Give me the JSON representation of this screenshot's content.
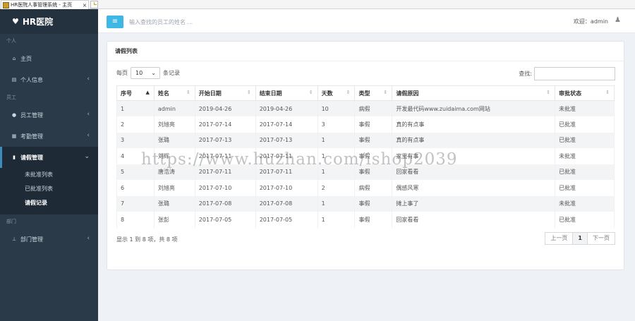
{
  "browser": {
    "tab_title": "HR医院人事管理系统 - 主页",
    "tab_close": "×"
  },
  "sidebar": {
    "brand": "HR医院",
    "sections": [
      {
        "label": "个人",
        "items": [
          {
            "label": "主页",
            "icon": "home-icon",
            "chevron": ""
          },
          {
            "label": "个人信息",
            "icon": "card-icon",
            "chevron": "‹"
          }
        ]
      },
      {
        "label": "员工",
        "items": [
          {
            "label": "员工管理",
            "icon": "user-icon",
            "chevron": "‹"
          },
          {
            "label": "考勤管理",
            "icon": "calendar-icon",
            "chevron": "‹"
          },
          {
            "label": "请假管理",
            "icon": "bookmark-icon",
            "chevron": "⌄"
          }
        ]
      },
      {
        "label": "部门",
        "items": [
          {
            "label": "部门管理",
            "icon": "sitemap-icon",
            "chevron": "‹"
          }
        ]
      }
    ],
    "submenu": [
      "未批准列表",
      "已批准列表",
      "请假记录"
    ]
  },
  "header": {
    "menu_toggle": "≡",
    "search_placeholder": "输入查找的员工的姓名 ...",
    "welcome": "欢迎：admin"
  },
  "panel": {
    "title": "请假列表",
    "length_prefix": "每页",
    "length_value": "10",
    "length_suffix": "条记录",
    "filter_label": "查找:",
    "columns": [
      "序号",
      "姓名",
      "开始日期",
      "结束日期",
      "天数",
      "类型",
      "请假原因",
      "审批状态"
    ],
    "rows": [
      [
        "1",
        "admin",
        "2019-04-26",
        "2019-04-26",
        "10",
        "病假",
        "开发最代码www.zuidaima.com网站",
        "未批准"
      ],
      [
        "2",
        "刘旭亮",
        "2017-07-14",
        "2017-07-14",
        "3",
        "事假",
        "真的有点事",
        "已批准"
      ],
      [
        "3",
        "张璐",
        "2017-07-13",
        "2017-07-13",
        "1",
        "事假",
        "真的有点事",
        "已批准"
      ],
      [
        "4",
        "刘辉",
        "2017-07-11",
        "2017-07-11",
        "1",
        "事假",
        "家里有事",
        "未批准"
      ],
      [
        "5",
        "唐浩涛",
        "2017-07-11",
        "2017-07-11",
        "1",
        "事假",
        "回家看看",
        "已批准"
      ],
      [
        "6",
        "刘旭亮",
        "2017-07-10",
        "2017-07-10",
        "2",
        "病假",
        "偶感风寒",
        "已批准"
      ],
      [
        "7",
        "张璐",
        "2017-07-08",
        "2017-07-08",
        "1",
        "事假",
        "摊上事了",
        "未批准"
      ],
      [
        "8",
        "张彭",
        "2017-07-05",
        "2017-07-05",
        "1",
        "事假",
        "回家看看",
        "已批准"
      ]
    ],
    "info": "显示 1 到 8 项，共 8 项",
    "pager": {
      "prev": "上一页",
      "current": "1",
      "next": "下一页"
    }
  },
  "watermark": "https://www.huzhan.com/ishop2039",
  "colors": {
    "sidebar": "#2b3a48",
    "accent": "#3fb7e4",
    "active_border": "#3c8dbc"
  }
}
